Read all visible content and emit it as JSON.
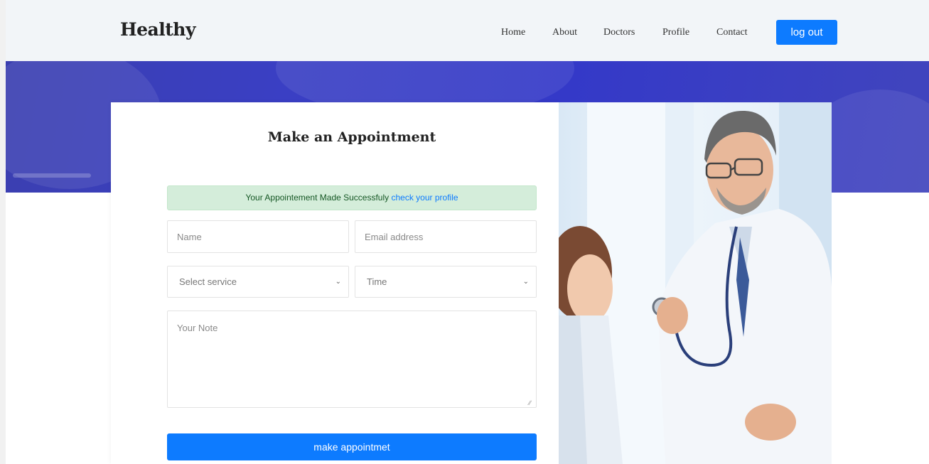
{
  "nav": {
    "brand": "Healthy",
    "links": [
      "Home",
      "About",
      "Doctors",
      "Profile",
      "Contact"
    ],
    "logout_label": "log out"
  },
  "form": {
    "title": "Make an Appointment",
    "alert_text": "Your Appointement Made Successfuly ",
    "alert_link": "check your profile",
    "name_placeholder": "Name",
    "email_placeholder": "Email address",
    "service_selected": "Select service",
    "time_selected": "Time",
    "note_placeholder": "Your Note",
    "submit_label": "make appointmet"
  },
  "colors": {
    "accent": "#0d7bff",
    "hero": "#3a3fc4",
    "alert_bg": "#d4edda"
  }
}
